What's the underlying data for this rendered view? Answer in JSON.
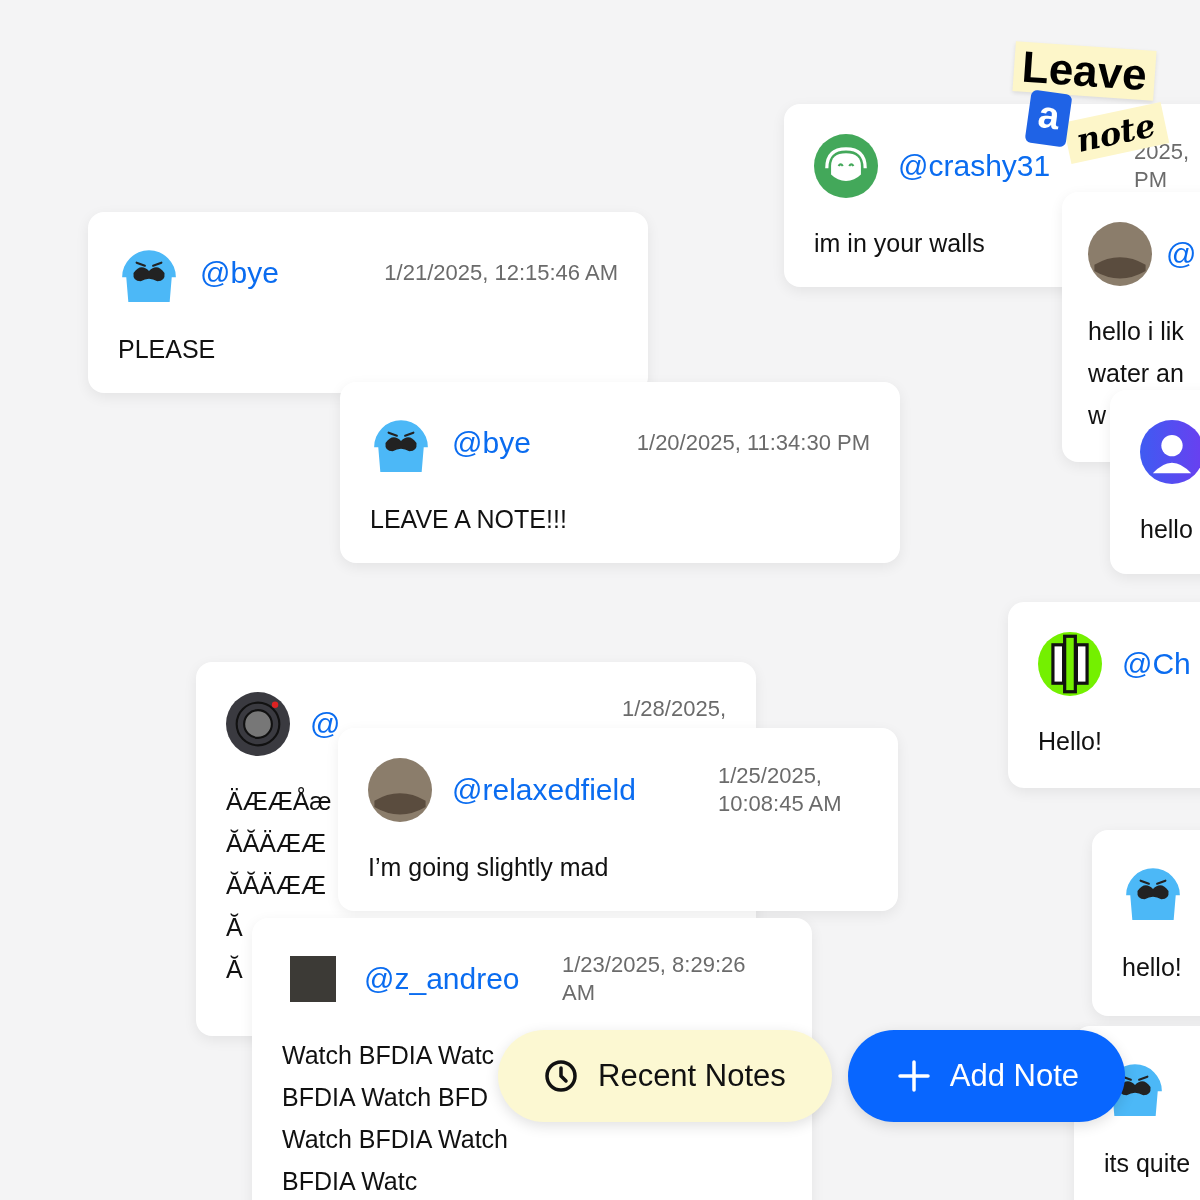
{
  "sticker": {
    "words": [
      "Leave",
      "a",
      "note"
    ]
  },
  "notes": [
    {
      "username": "@bye",
      "date": "1/21/2025, 12:15:46 AM",
      "body_lines": [
        "PLEASE"
      ]
    },
    {
      "username": "@bye",
      "date": "1/20/2025, 11:34:30 PM",
      "body_lines": [
        "LEAVE A NOTE!!!"
      ]
    },
    {
      "username": "@crashy31",
      "date": "2025, PM",
      "body_lines": [
        "im in your walls"
      ]
    },
    {
      "username": "@",
      "body_lines": [
        "hello i lik",
        "water an",
        "w"
      ]
    },
    {
      "body_lines": [
        "hello"
      ]
    },
    {
      "username": "@Ch",
      "body_lines": [
        "Hello!"
      ]
    },
    {
      "username": "@",
      "date": "1/28/2025,",
      "body_lines": [
        "ÄÆÆÅæ",
        "ĂĂÄÆÆ",
        "ĂĂÄÆÆ",
        "Ă",
        "Ă"
      ]
    },
    {
      "username": "@relaxedfield",
      "date": "1/25/2025, 10:08:45 AM",
      "body_lines": [
        "I’m going slightly mad"
      ]
    },
    {
      "username": "@z_andreo",
      "date": "1/23/2025, 8:29:26 AM",
      "body_lines": [
        "Watch BFDIA Watc",
        "BFDIA Watch BFD",
        "Watch BFDIA Watch",
        "BFDIA Watc"
      ]
    },
    {
      "body_lines": [
        "hello!"
      ]
    },
    {
      "body_lines": [
        "its quite"
      ]
    }
  ],
  "buttons": [
    {
      "kind": "recent",
      "label": "Recent Notes"
    },
    {
      "kind": "add",
      "label": "Add Note"
    }
  ]
}
